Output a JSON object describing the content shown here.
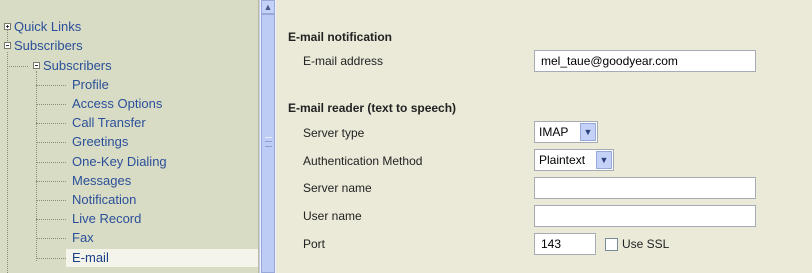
{
  "tree": {
    "quick_links": "Quick Links",
    "subscribers": "Subscribers",
    "subscribers_child": "Subscribers",
    "items": [
      "Profile",
      "Access Options",
      "Call Transfer",
      "Greetings",
      "One-Key Dialing",
      "Messages",
      "Notification",
      "Live Record",
      "Fax",
      "E-mail"
    ],
    "selected": "E-mail"
  },
  "scrollbar": {
    "up_arrow": "▲"
  },
  "email_notification": {
    "title": "E-mail notification",
    "address_label": "E-mail address",
    "address_value": "mel_taue@goodyear.com"
  },
  "email_reader": {
    "title": "E-mail reader (text to speech)",
    "server_type_label": "Server type",
    "server_type_value": "IMAP",
    "auth_method_label": "Authentication Method",
    "auth_method_value": "Plaintext",
    "server_name_label": "Server name",
    "server_name_value": "",
    "user_name_label": "User name",
    "user_name_value": "",
    "port_label": "Port",
    "port_value": "143",
    "use_ssl_label": "Use SSL",
    "use_ssl_checked": false
  },
  "icons": {
    "dropdown": "▼"
  }
}
